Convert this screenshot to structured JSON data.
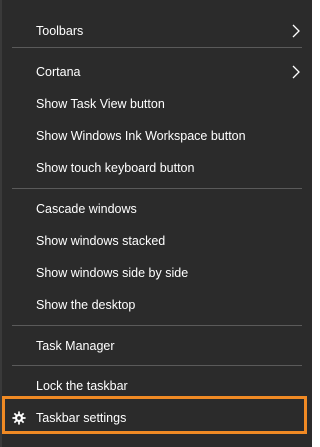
{
  "menu": {
    "items": [
      {
        "label": "Toolbars",
        "icon": "chevron-right-icon"
      },
      {
        "label": "Cortana",
        "icon": "chevron-right-icon"
      },
      {
        "label": "Show Task View button"
      },
      {
        "label": "Show Windows Ink Workspace button"
      },
      {
        "label": "Show touch keyboard button"
      },
      {
        "label": "Cascade windows"
      },
      {
        "label": "Show windows stacked"
      },
      {
        "label": "Show windows side by side"
      },
      {
        "label": "Show the desktop"
      },
      {
        "label": "Task Manager"
      },
      {
        "label": "Lock the taskbar"
      },
      {
        "label": "Taskbar settings",
        "icon": "gear-icon"
      }
    ]
  },
  "colors": {
    "menu_background": "#2b2b2b",
    "separator": "#5a5a5a",
    "text": "#ffffff",
    "highlight_border": "#f08a24"
  }
}
